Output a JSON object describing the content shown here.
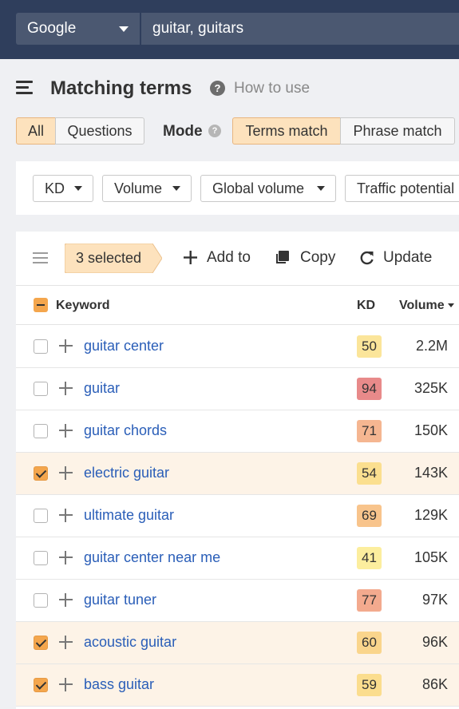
{
  "search": {
    "engine": "Google",
    "query": "guitar, guitars"
  },
  "header": {
    "title": "Matching terms",
    "help_glyph": "?",
    "how_to_use": "How to use"
  },
  "filters": {
    "all_label": "All",
    "questions_label": "Questions",
    "mode_label": "Mode",
    "mode_help_glyph": "?",
    "terms_match_label": "Terms match",
    "phrase_match_label": "Phrase match",
    "active_scope": "All",
    "active_mode": "Terms match"
  },
  "dropdowns": [
    {
      "label": "KD"
    },
    {
      "label": "Volume"
    },
    {
      "label": "Global volume"
    },
    {
      "label": "Traffic potential"
    }
  ],
  "toolbar": {
    "selected_label": "3 selected",
    "add_to_label": "Add to",
    "copy_label": "Copy",
    "update_label": "Update"
  },
  "table": {
    "columns": {
      "keyword": "Keyword",
      "kd": "KD",
      "volume": "Volume"
    },
    "sort_column": "Volume",
    "sort_direction": "desc",
    "rows": [
      {
        "keyword": "guitar center",
        "kd": "50",
        "kd_color": "#fbe59a",
        "volume": "2.2M",
        "selected": false
      },
      {
        "keyword": "guitar",
        "kd": "94",
        "kd_color": "#e88a8a",
        "volume": "325K",
        "selected": false
      },
      {
        "keyword": "guitar chords",
        "kd": "71",
        "kd_color": "#f5b691",
        "volume": "150K",
        "selected": false
      },
      {
        "keyword": "electric guitar",
        "kd": "54",
        "kd_color": "#fbdf8f",
        "volume": "143K",
        "selected": true
      },
      {
        "keyword": "ultimate guitar",
        "kd": "69",
        "kd_color": "#f8c48c",
        "volume": "129K",
        "selected": false
      },
      {
        "keyword": "guitar center near me",
        "kd": "41",
        "kd_color": "#fcee9e",
        "volume": "105K",
        "selected": false
      },
      {
        "keyword": "guitar tuner",
        "kd": "77",
        "kd_color": "#f3aa8e",
        "volume": "97K",
        "selected": false
      },
      {
        "keyword": "acoustic guitar",
        "kd": "60",
        "kd_color": "#fad58c",
        "volume": "96K",
        "selected": true
      },
      {
        "keyword": "bass guitar",
        "kd": "59",
        "kd_color": "#fbdd8e",
        "volume": "86K",
        "selected": true
      }
    ]
  },
  "colors": {
    "topbar": "#2f3e5c",
    "accent_orange": "#f4a64d",
    "selected_row": "#fdf3e7",
    "link_blue": "#2a5eb8"
  }
}
